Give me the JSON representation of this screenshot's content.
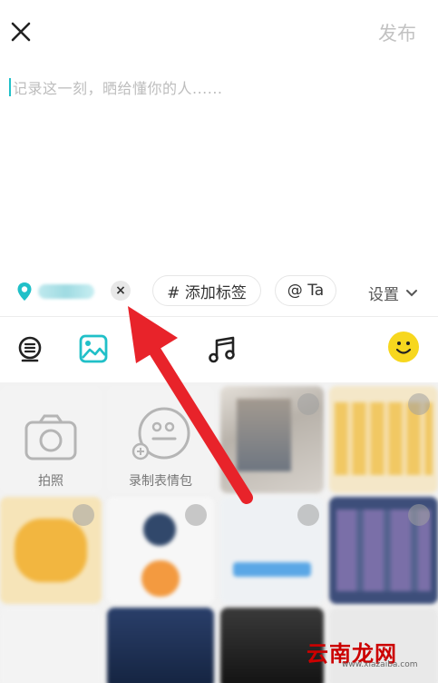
{
  "header": {
    "publish_label": "发布"
  },
  "editor": {
    "placeholder": "记录这一刻，晒给懂你的人......"
  },
  "toolbar": {
    "remove_location_label": "×",
    "add_tag_label": "# 添加标签",
    "mention_label": "@ Ta",
    "settings_label": "设置"
  },
  "icons": {
    "voice": "voice-icon",
    "image": "image-icon",
    "music": "music-note-icon",
    "emoji": "smiley-icon"
  },
  "colors": {
    "accent": "#20c0c8",
    "arrow": "#e8232a",
    "emoji": "#f7d71e"
  },
  "gallery": {
    "camera_label": "拍照",
    "record_sticker_label": "录制表情包"
  },
  "watermark": {
    "text": "云南龙网",
    "sub": "www.xiazaiba.com"
  }
}
